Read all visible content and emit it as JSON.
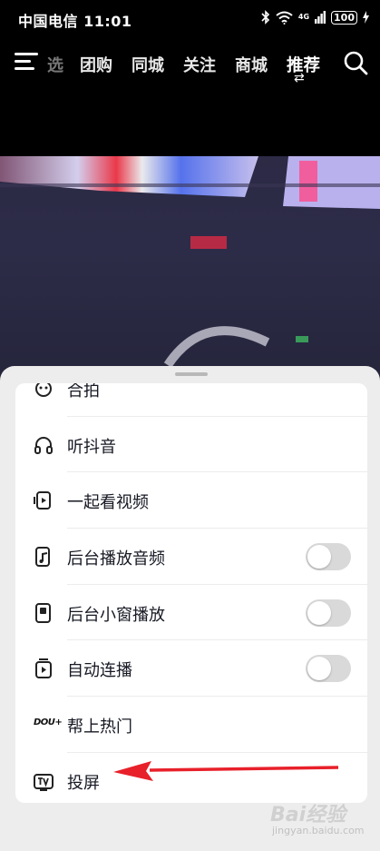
{
  "status_bar": {
    "carrier": "中国电信",
    "time": "11:01",
    "network": "4G",
    "battery": "100",
    "icons": [
      "bluetooth-icon",
      "wifi-icon",
      "signal-icon",
      "battery-icon",
      "charging-icon"
    ]
  },
  "nav": {
    "tabs": [
      {
        "label": "选",
        "state": "faded"
      },
      {
        "label": "团购"
      },
      {
        "label": "同城"
      },
      {
        "label": "关注"
      },
      {
        "label": "商城"
      },
      {
        "label": "推荐",
        "state": "active"
      }
    ],
    "icons": [
      "menu-icon",
      "refresh-icon",
      "search-icon"
    ]
  },
  "colors": {
    "sheet_bg": "#ededed",
    "card_bg": "#ffffff",
    "toggle_off": "#d9d9d9",
    "annotation_arrow": "#e8202a",
    "text": "#161823"
  },
  "menu": {
    "items": [
      {
        "label": "合拍",
        "icon": "duet-icon",
        "toggle": null
      },
      {
        "label": "听抖音",
        "icon": "headphones-icon",
        "toggle": null
      },
      {
        "label": "一起看视频",
        "icon": "watch-together-icon",
        "toggle": null
      },
      {
        "label": "后台播放音频",
        "icon": "background-audio-icon",
        "toggle": false
      },
      {
        "label": "后台小窗播放",
        "icon": "mini-window-icon",
        "toggle": false
      },
      {
        "label": "自动连播",
        "icon": "autoplay-icon",
        "toggle": false
      },
      {
        "label": "帮上热门",
        "icon": "dou-plus-icon",
        "icon_text": "DOU+",
        "toggle": null
      },
      {
        "label": "投屏",
        "icon": "tv-cast-icon",
        "toggle": null
      }
    ]
  },
  "watermark": {
    "main": "Bai经验",
    "sub": "jingyan.baidu.com"
  }
}
